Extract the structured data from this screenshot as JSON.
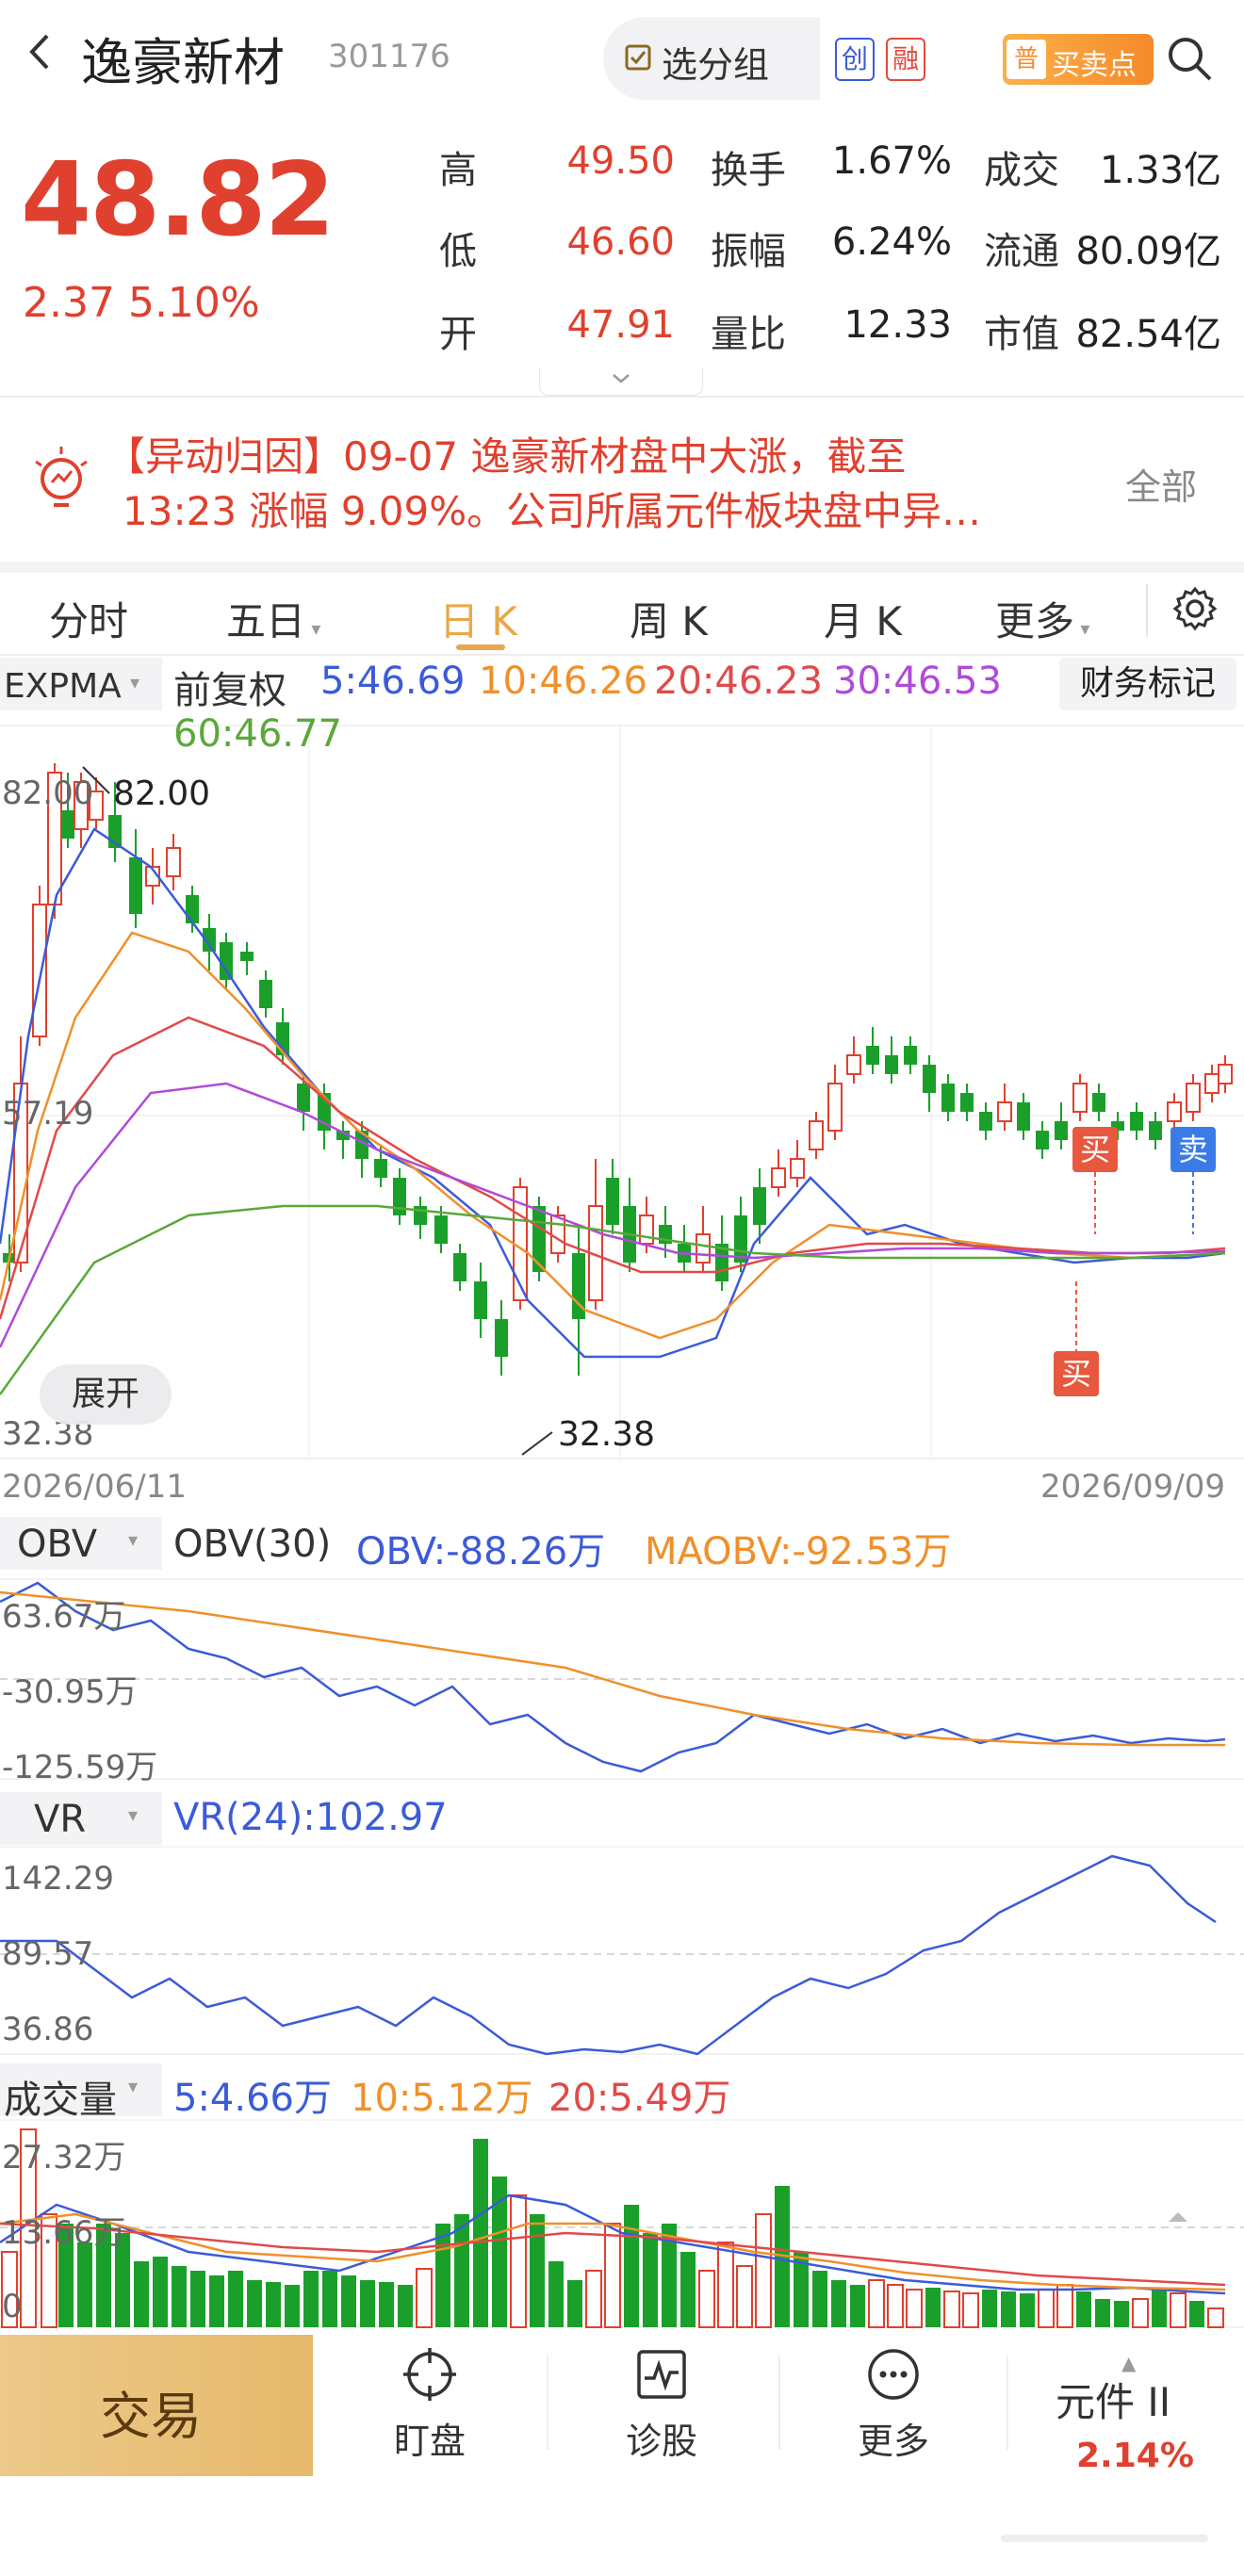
{
  "header": {
    "stock_name": "逸豪新材",
    "stock_code": "301176",
    "group_button": "选分组",
    "tag_chuang": "创",
    "tag_rong": "融",
    "buysell_icon": "普",
    "buysell_label": "买卖点"
  },
  "quote": {
    "price": "48.82",
    "change": "2.37  5.10%",
    "rows": [
      {
        "l1": "高",
        "v1": "49.50",
        "l2": "换手",
        "v2": "1.67%",
        "l3": "成交",
        "v3": "1.33亿"
      },
      {
        "l1": "低",
        "v1": "46.60",
        "l2": "振幅",
        "v2": "6.24%",
        "l3": "流通",
        "v3": "80.09亿"
      },
      {
        "l1": "开",
        "v1": "47.91",
        "l2": "量比",
        "v2": "12.33",
        "l3": "市值",
        "v3": "82.54亿"
      }
    ]
  },
  "alert": {
    "text": "【异动归因】09-07 逸豪新材盘中大涨，截至13:23 涨幅 9.09%。公司所属元件板块盘中异…",
    "line1": "【异动归因】09-07 逸豪新材盘中大涨，截至",
    "line2": "13:23 涨幅 9.09%。公司所属元件板块盘中异…",
    "all_label": "全部"
  },
  "tabs": [
    {
      "label": "分时",
      "dropdown": false
    },
    {
      "label": "五日",
      "dropdown": true
    },
    {
      "label": "日 K",
      "dropdown": false,
      "active": true
    },
    {
      "label": "周 K",
      "dropdown": false
    },
    {
      "label": "月 K",
      "dropdown": false
    },
    {
      "label": "更多",
      "dropdown": true
    }
  ],
  "kline": {
    "indicator": "EXPMA",
    "adjust": "前复权",
    "ma": [
      {
        "label": "5:46.69",
        "color": "#3b5bd8"
      },
      {
        "label": "10:46.26",
        "color": "#f0902a"
      },
      {
        "label": "20:46.23",
        "color": "#e04a4a"
      },
      {
        "label": "30:46.53",
        "color": "#b04ad8"
      },
      {
        "label": "60:46.77",
        "color": "#5aa83a"
      }
    ],
    "finance_button": "财务标记",
    "y_top": "82.00",
    "y_mid": "57.19",
    "y_bottom": "32.38",
    "high_label": "82.00",
    "low_label": "32.38",
    "date_start": "2026/06/11",
    "date_end": "2026/09/09",
    "expand_label": "展开",
    "buy_label": "买",
    "sell_label": "卖"
  },
  "obv": {
    "indicator": "OBV",
    "params": "OBV(30)",
    "obv_label": "OBV:-88.26万",
    "maobv_label": "MAOBV:-92.53万",
    "y_top": "63.67万",
    "y_mid": "-30.95万",
    "y_bottom": "-125.59万"
  },
  "vr": {
    "indicator": "VR",
    "value_label": "VR(24):102.97",
    "y_top": "142.29",
    "y_mid": "89.57",
    "y_bottom": "36.86"
  },
  "volume": {
    "indicator": "成交量",
    "ma": [
      {
        "label": "5:4.66万",
        "color": "#3b5bd8"
      },
      {
        "label": "10:5.12万",
        "color": "#f0902a"
      },
      {
        "label": "20:5.49万",
        "color": "#e04a4a"
      }
    ],
    "y_top": "27.32万",
    "y_mid": "13.66万",
    "y_bottom": "0"
  },
  "bottom_nav": {
    "trade": "交易",
    "items": [
      {
        "label": "盯盘",
        "icon": "crosshair-icon"
      },
      {
        "label": "诊股",
        "icon": "pulse-icon"
      },
      {
        "label": "更多",
        "icon": "more-dots-icon"
      }
    ],
    "sector_name": "元件 II",
    "sector_pct": "2.14%"
  },
  "colors": {
    "up": "#e0402e",
    "down": "#1aa02a",
    "accent": "#e8a84a"
  }
}
